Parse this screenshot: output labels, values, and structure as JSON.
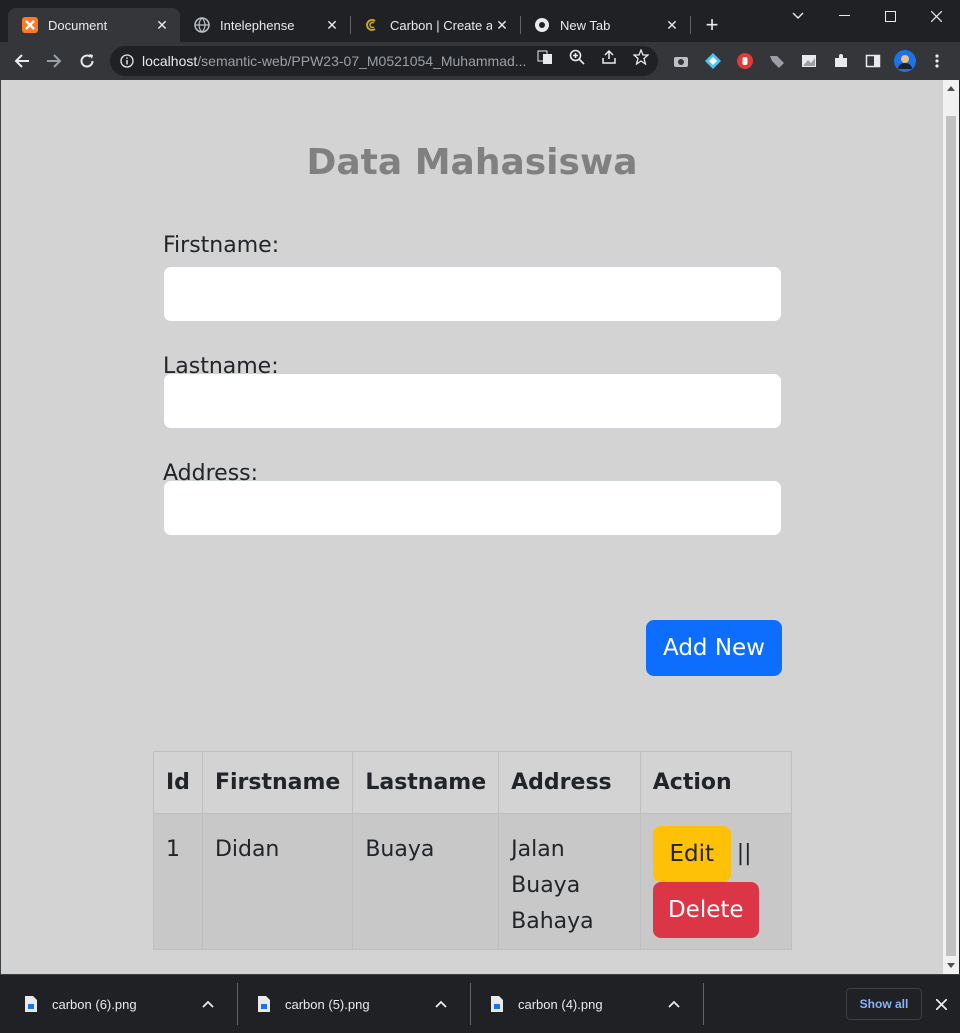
{
  "browser": {
    "tabs": [
      {
        "title": "Document",
        "active": true
      },
      {
        "title": "Intelephense",
        "active": false
      },
      {
        "title": "Carbon | Create and",
        "active": false
      },
      {
        "title": "New Tab",
        "active": false
      }
    ],
    "new_tab_symbol": "+",
    "address": {
      "host": "localhost",
      "path": "/semantic-web/PPW23-07_M0521054_Muhammad..."
    },
    "colors": {
      "frame": "#202124",
      "toolbar": "#35363a",
      "accent": "#8ab4f8"
    }
  },
  "page": {
    "title": "Data Mahasiswa",
    "background": "#d3d3d3",
    "form": {
      "firstname_label": "Firstname:",
      "lastname_label": "Lastname:",
      "address_label": "Address:",
      "firstname_value": "",
      "lastname_value": "",
      "address_value": "",
      "add_button": "Add New"
    },
    "table": {
      "headers": {
        "id": "Id",
        "firstname": "Firstname",
        "lastname": "Lastname",
        "address": "Address",
        "action": "Action"
      },
      "rows": [
        {
          "id": "1",
          "firstname": "Didan",
          "lastname": "Buaya",
          "address": "Jalan Buaya Bahaya",
          "edit": "Edit",
          "separator": "||",
          "delete": "Delete"
        }
      ]
    },
    "button_colors": {
      "add": "#0d6efd",
      "edit": "#ffc107",
      "delete": "#dc3545"
    }
  },
  "downloads": {
    "items": [
      {
        "name": "carbon (6).png"
      },
      {
        "name": "carbon (5).png"
      },
      {
        "name": "carbon (4).png"
      }
    ],
    "show_all": "Show all"
  }
}
